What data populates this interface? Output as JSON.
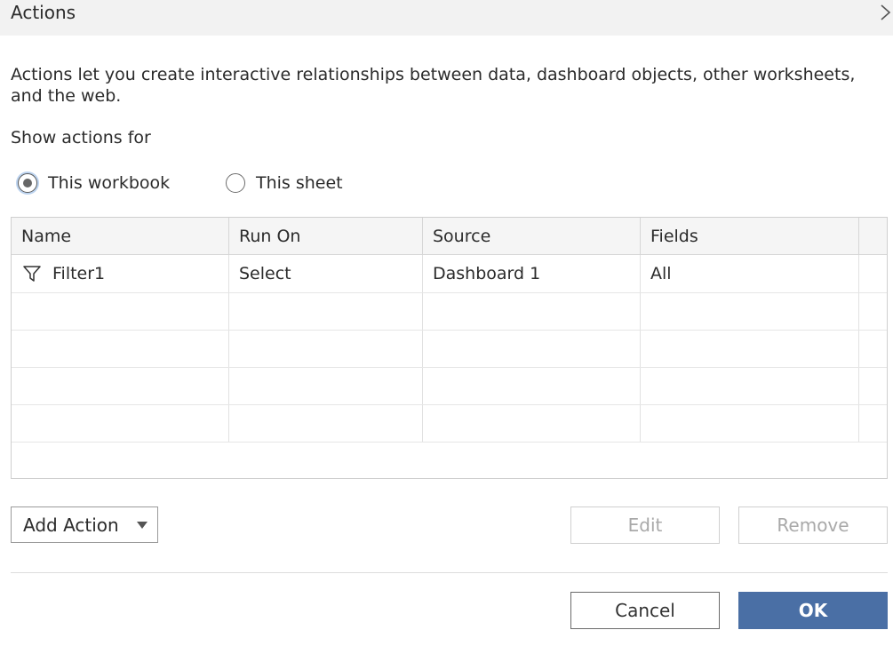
{
  "dialog": {
    "title": "Actions",
    "description": "Actions let you create interactive relationships between data, dashboard objects, other worksheets, and the web.",
    "show_actions_for_label": "Show actions for",
    "scope_options": [
      {
        "label": "This workbook",
        "selected": true
      },
      {
        "label": "This sheet",
        "selected": false
      }
    ]
  },
  "table": {
    "columns": [
      "Name",
      "Run On",
      "Source",
      "Fields"
    ],
    "rows": [
      {
        "name": "Filter1",
        "icon": "filter-icon",
        "run_on": "Select",
        "source": "Dashboard 1",
        "fields": "All"
      }
    ]
  },
  "buttons": {
    "add_action": "Add Action",
    "edit": "Edit",
    "remove": "Remove",
    "cancel": "Cancel",
    "ok": "OK"
  },
  "colors": {
    "titlebar_bg": "#f2f2f2",
    "primary_button": "#4a6fa5",
    "disabled_text": "#a9a9a9"
  }
}
